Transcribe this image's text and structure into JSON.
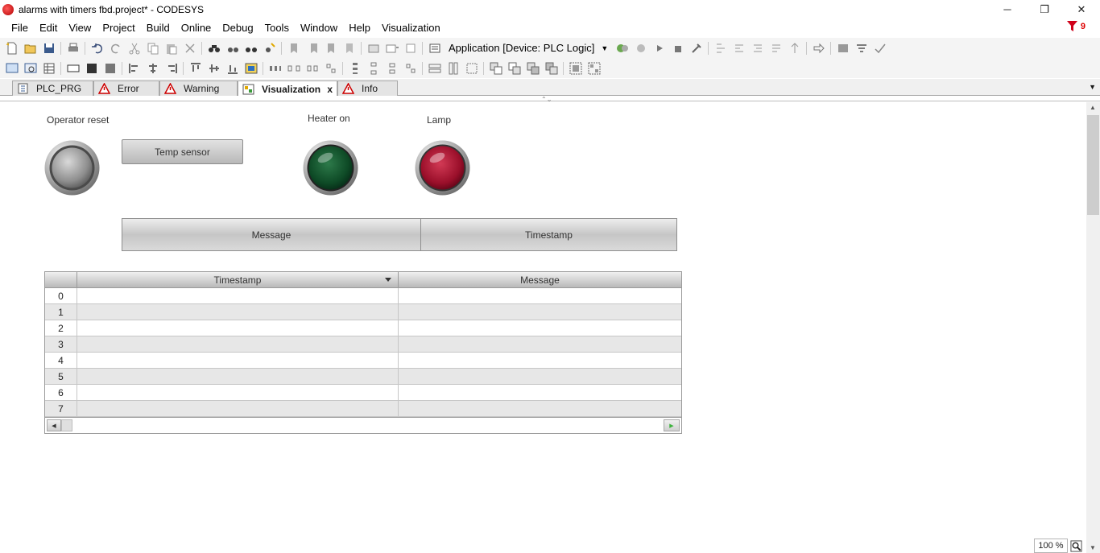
{
  "window": {
    "title": "alarms with timers fbd.project* - CODESYS",
    "controls": {
      "minimize": "─",
      "restore": "❐",
      "close": "✕"
    }
  },
  "menu": [
    "File",
    "Edit",
    "View",
    "Project",
    "Build",
    "Online",
    "Debug",
    "Tools",
    "Window",
    "Help",
    "Visualization"
  ],
  "message_indicator": {
    "count": "9",
    "color": "#d0021b"
  },
  "toolbar": {
    "application_selector": "Application [Device: PLC Logic]"
  },
  "tabs": [
    {
      "label": "PLC_PRG",
      "icon": "pou-icon",
      "active": false
    },
    {
      "label": "Error",
      "icon": "warning-icon",
      "active": false
    },
    {
      "label": "Warning",
      "icon": "warning-icon",
      "active": false
    },
    {
      "label": "Visualization",
      "icon": "visualization-icon",
      "active": true,
      "close": "x"
    },
    {
      "label": "Info",
      "icon": "warning-icon",
      "active": false
    }
  ],
  "visualization": {
    "operator_reset_label": "Operator reset",
    "temp_sensor_button": "Temp sensor",
    "heater_label": "Heater on",
    "lamp_label": "Lamp",
    "banner": {
      "message_header": "Message",
      "timestamp_header": "Timestamp"
    },
    "alarm_table": {
      "columns": [
        "Timestamp",
        "Message"
      ],
      "rows": [
        {
          "index": "0",
          "timestamp": "",
          "message": ""
        },
        {
          "index": "1",
          "timestamp": "",
          "message": ""
        },
        {
          "index": "2",
          "timestamp": "",
          "message": ""
        },
        {
          "index": "3",
          "timestamp": "",
          "message": ""
        },
        {
          "index": "4",
          "timestamp": "",
          "message": ""
        },
        {
          "index": "5",
          "timestamp": "",
          "message": ""
        },
        {
          "index": "6",
          "timestamp": "",
          "message": ""
        },
        {
          "index": "7",
          "timestamp": "",
          "message": ""
        }
      ]
    },
    "lamps": {
      "heater_color": "#0e5a2c",
      "lamp_color": "#a0102c"
    }
  },
  "zoom": "100 %"
}
